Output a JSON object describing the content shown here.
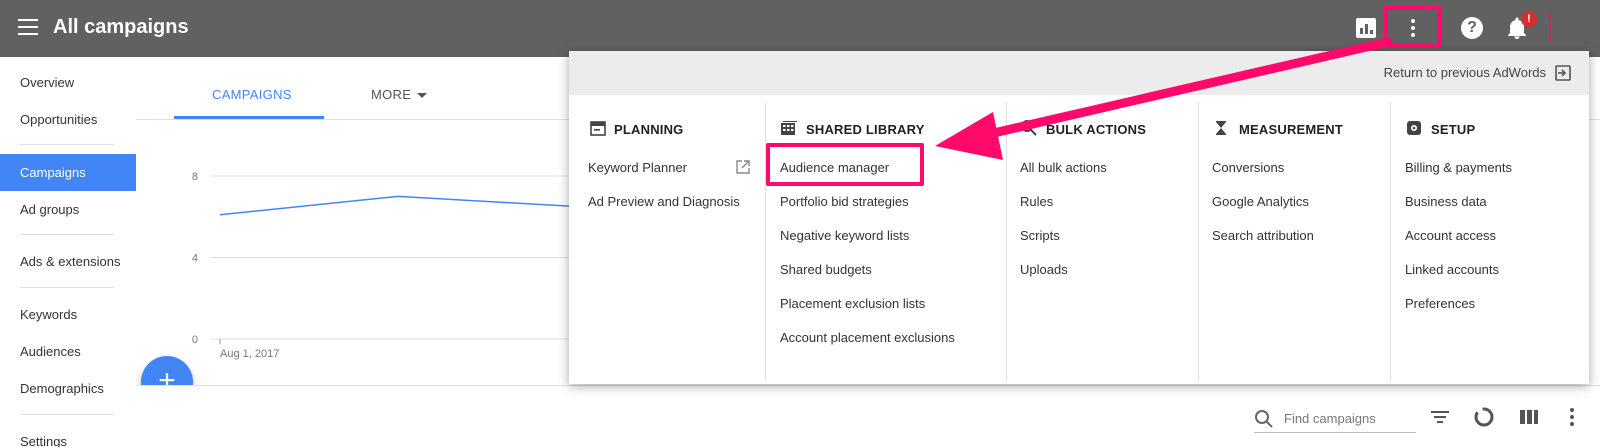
{
  "header": {
    "title": "All campaigns",
    "notification_badge": "!"
  },
  "sidenav": {
    "items": [
      {
        "label": "Overview"
      },
      {
        "label": "Opportunities"
      },
      {
        "label": "Campaigns",
        "active": true
      },
      {
        "label": "Ad groups"
      },
      {
        "label": "Ads & extensions"
      },
      {
        "label": "Keywords"
      },
      {
        "label": "Audiences"
      },
      {
        "label": "Demographics"
      },
      {
        "label": "Settings"
      }
    ]
  },
  "tabs": {
    "campaigns": "CAMPAIGNS",
    "more": "MORE"
  },
  "chart_data": {
    "type": "line",
    "x": [
      "Aug 1, 2017"
    ],
    "yticks": [
      "8",
      "4",
      "0"
    ],
    "ylim": [
      0,
      8
    ],
    "series": [
      {
        "values": [
          6.1,
          7.0,
          6.5
        ]
      }
    ],
    "grid": true
  },
  "fab": {
    "label": "+"
  },
  "search": {
    "placeholder": "Find campaigns"
  },
  "dropdown": {
    "return_link": "Return to previous AdWords",
    "columns": [
      {
        "heading": "PLANNING",
        "links": [
          "Keyword Planner",
          "Ad Preview and Diagnosis"
        ]
      },
      {
        "heading": "SHARED LIBRARY",
        "links": [
          "Audience manager",
          "Portfolio bid strategies",
          "Negative keyword lists",
          "Shared budgets",
          "Placement exclusion lists",
          "Account placement exclusions"
        ]
      },
      {
        "heading": "BULK ACTIONS",
        "links": [
          "All bulk actions",
          "Rules",
          "Scripts",
          "Uploads"
        ]
      },
      {
        "heading": "MEASUREMENT",
        "links": [
          "Conversions",
          "Google Analytics",
          "Search attribution"
        ]
      },
      {
        "heading": "SETUP",
        "links": [
          "Billing & payments",
          "Business data",
          "Account access",
          "Linked accounts",
          "Preferences"
        ]
      }
    ]
  },
  "colors": {
    "topbar": "#616161",
    "accent": "#4285f4",
    "annotation": "#ff0a6a"
  }
}
